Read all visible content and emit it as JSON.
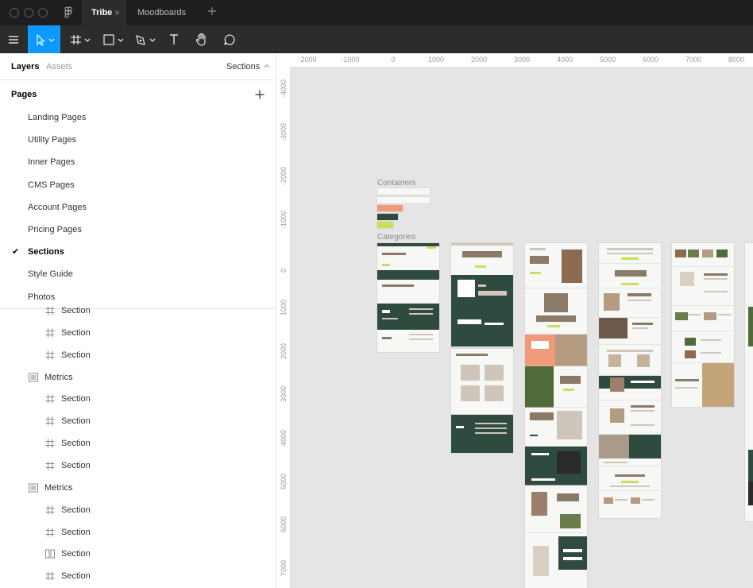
{
  "tabs": [
    {
      "label": "Tribe",
      "active": true
    },
    {
      "label": "Moodboards",
      "active": false
    }
  ],
  "tab_close_glyph": "×",
  "toolbar": {
    "icons": [
      "menu-icon",
      "move-tool-icon",
      "frame-tool-icon",
      "shape-tool-icon",
      "pen-tool-icon",
      "text-tool-icon",
      "hand-tool-icon",
      "comment-tool-icon"
    ],
    "active_tool": "move-tool-icon",
    "accent": "#0d99ff"
  },
  "panel": {
    "tab_layers": "Layers",
    "tab_assets": "Assets",
    "current_page_select": "Sections",
    "pages_title": "Pages",
    "pages": [
      {
        "label": "Landing Pages",
        "current": false
      },
      {
        "label": "Utility Pages",
        "current": false
      },
      {
        "label": "Inner Pages",
        "current": false
      },
      {
        "label": "CMS Pages",
        "current": false
      },
      {
        "label": "Account Pages",
        "current": false
      },
      {
        "label": "Pricing Pages",
        "current": false
      },
      {
        "label": "Sections",
        "current": true
      },
      {
        "label": "Style Guide",
        "current": false
      },
      {
        "label": "Photos",
        "current": false
      }
    ],
    "check_glyph": "✔",
    "layers": [
      {
        "label": "Section",
        "icon": "frame-icon",
        "indent": 2
      },
      {
        "label": "Section",
        "icon": "frame-icon",
        "indent": 2
      },
      {
        "label": "Section",
        "icon": "frame-icon",
        "indent": 2
      },
      {
        "label": "Metrics",
        "icon": "vertical-stack-icon",
        "indent": 1
      },
      {
        "label": "Section",
        "icon": "frame-icon",
        "indent": 2
      },
      {
        "label": "Section",
        "icon": "frame-icon",
        "indent": 2
      },
      {
        "label": "Section",
        "icon": "frame-icon",
        "indent": 2
      },
      {
        "label": "Section",
        "icon": "frame-icon",
        "indent": 2
      },
      {
        "label": "Metrics",
        "icon": "vertical-stack-icon",
        "indent": 1
      },
      {
        "label": "Section",
        "icon": "frame-icon",
        "indent": 2
      },
      {
        "label": "Section",
        "icon": "frame-icon",
        "indent": 2
      },
      {
        "label": "Section",
        "icon": "columns-icon",
        "indent": 2
      },
      {
        "label": "Section",
        "icon": "frame-icon",
        "indent": 2
      }
    ]
  },
  "canvas": {
    "ruler_x": [
      "-2000",
      "-1000",
      "0",
      "1000",
      "2000",
      "3000",
      "4000",
      "5000",
      "6000",
      "7000",
      "8000"
    ],
    "ruler_y": [
      "-4000",
      "-3000",
      "-2000",
      "-1000",
      "0",
      "1000",
      "2000",
      "3000",
      "4000",
      "5000",
      "6000",
      "7000"
    ],
    "containers_label": "Containers",
    "categories_label": "Categories",
    "colors": {
      "canvas_bg": "#e5e5e5",
      "frame_bg": "#f7f7f5",
      "dark_green": "#2f4a3e",
      "salmon": "#ef9a78",
      "lime": "#c9e05a"
    }
  }
}
